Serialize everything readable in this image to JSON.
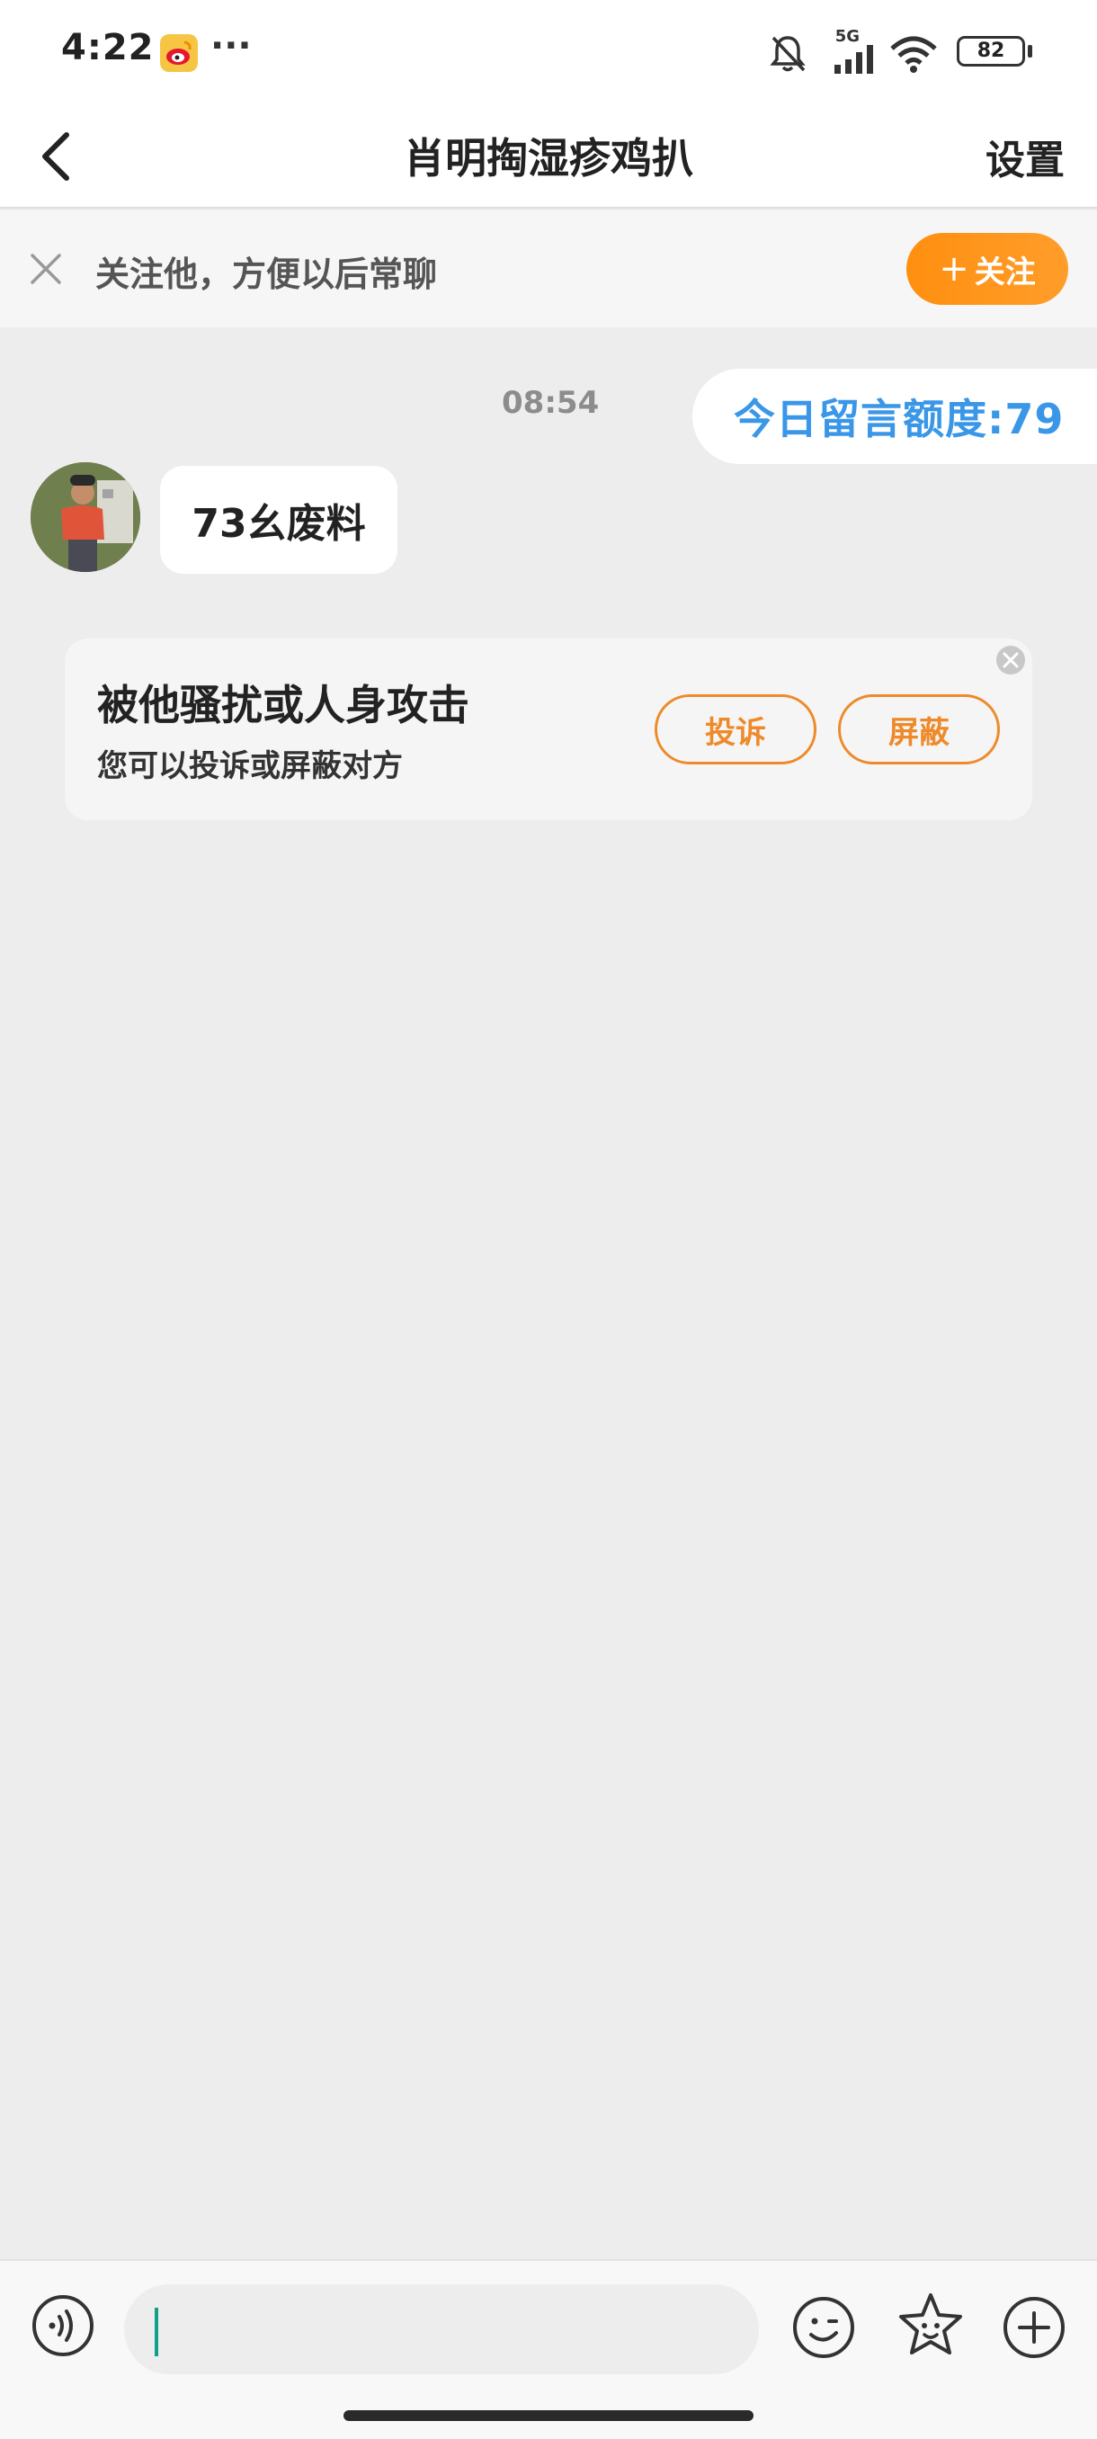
{
  "status_bar": {
    "time": "4:22",
    "dots": "···",
    "network": "5G",
    "battery": "82"
  },
  "nav": {
    "title": "肖明掏湿疹鸡扒",
    "settings": "设置"
  },
  "follow_banner": {
    "text": "关注他，方便以后常聊",
    "button": "关注",
    "button_icon": "+"
  },
  "chat": {
    "time": "08:54",
    "quota_message": "今日留言额度:79",
    "incoming_message": "73幺废料"
  },
  "report_card": {
    "title": "被他骚扰或人身攻击",
    "subtitle": "您可以投诉或屏蔽对方",
    "report_button": "投诉",
    "block_button": "屏蔽"
  },
  "input_bar": {
    "value": "",
    "icons": [
      "voice-icon",
      "emoji-icon",
      "sticker-icon",
      "plus-icon"
    ]
  },
  "colors": {
    "accent_orange": "#ff9418",
    "link_blue": "#3a97e8",
    "background": "#ededed"
  }
}
